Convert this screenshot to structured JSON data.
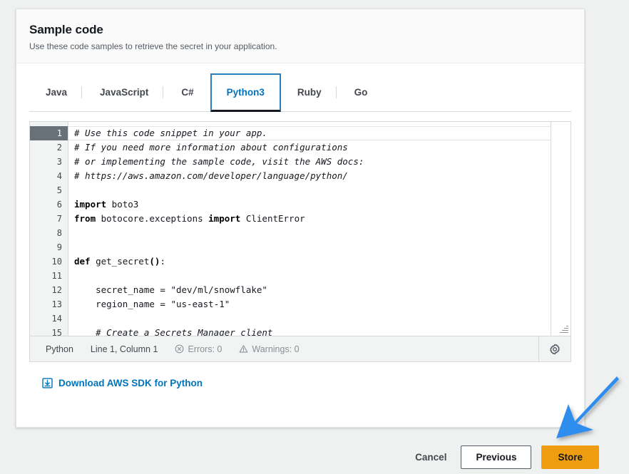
{
  "card": {
    "title": "Sample code",
    "subtitle": "Use these code samples to retrieve the secret in your application."
  },
  "tabs": [
    {
      "label": "Java",
      "active": false
    },
    {
      "label": "JavaScript",
      "active": false
    },
    {
      "label": "C#",
      "active": false
    },
    {
      "label": "Python3",
      "active": true
    },
    {
      "label": "Ruby",
      "active": false
    },
    {
      "label": "Go",
      "active": false
    }
  ],
  "editor": {
    "language": "Python",
    "active_line": 1,
    "lines": [
      {
        "n": 1,
        "segments": [
          {
            "t": "# Use this code snippet in your app.",
            "k": "comment"
          }
        ]
      },
      {
        "n": 2,
        "segments": [
          {
            "t": "# If you need more information about configurations",
            "k": "comment"
          }
        ]
      },
      {
        "n": 3,
        "segments": [
          {
            "t": "# or implementing the sample code, visit the AWS docs:",
            "k": "comment"
          }
        ]
      },
      {
        "n": 4,
        "segments": [
          {
            "t": "# https://aws.amazon.com/developer/language/python/",
            "k": "comment"
          }
        ]
      },
      {
        "n": 5,
        "segments": []
      },
      {
        "n": 6,
        "segments": [
          {
            "t": "import",
            "k": "kw"
          },
          {
            "t": " boto3",
            "k": "plain"
          }
        ]
      },
      {
        "n": 7,
        "segments": [
          {
            "t": "from",
            "k": "kw"
          },
          {
            "t": " botocore.exceptions ",
            "k": "plain"
          },
          {
            "t": "import",
            "k": "kw"
          },
          {
            "t": " ClientError",
            "k": "plain"
          }
        ]
      },
      {
        "n": 8,
        "segments": []
      },
      {
        "n": 9,
        "segments": []
      },
      {
        "n": 10,
        "segments": [
          {
            "t": "def",
            "k": "kw"
          },
          {
            "t": " get_secret",
            "k": "plain"
          },
          {
            "t": "()",
            "k": "paren"
          },
          {
            "t": ":",
            "k": "plain"
          }
        ]
      },
      {
        "n": 11,
        "segments": []
      },
      {
        "n": 12,
        "segments": [
          {
            "t": "    secret_name = ",
            "k": "plain"
          },
          {
            "t": "\"dev/ml/snowflake\"",
            "k": "str"
          }
        ]
      },
      {
        "n": 13,
        "segments": [
          {
            "t": "    region_name = ",
            "k": "plain"
          },
          {
            "t": "\"us-east-1\"",
            "k": "str"
          }
        ]
      },
      {
        "n": 14,
        "segments": []
      },
      {
        "n": 15,
        "segments": [
          {
            "t": "    # Create a Secrets Manager client",
            "k": "comment"
          }
        ]
      }
    ]
  },
  "status_bar": {
    "language": "Python",
    "cursor": "Line 1, Column 1",
    "errors": "Errors: 0",
    "warnings": "Warnings: 0",
    "settings_icon": "gear-icon",
    "error_icon": "error-circle-icon",
    "warning_icon": "warning-triangle-icon"
  },
  "download": {
    "icon": "download-icon",
    "label": "Download AWS SDK for Python"
  },
  "footer": {
    "cancel_label": "Cancel",
    "previous_label": "Previous",
    "store_label": "Store"
  },
  "annotation": {
    "arrow": "blue-arrow-pointing-to-store-button",
    "color": "#2e8ded"
  },
  "colors": {
    "page_background": "#eff1f1",
    "card_background": "#ffffff",
    "header_background": "#fafafa",
    "accent_link": "#0073bb",
    "primary_button": "#ee9c10",
    "active_tab_text": "#0073bb",
    "gutter_active": "#687078",
    "annotation_blue": "#2e8ded"
  }
}
